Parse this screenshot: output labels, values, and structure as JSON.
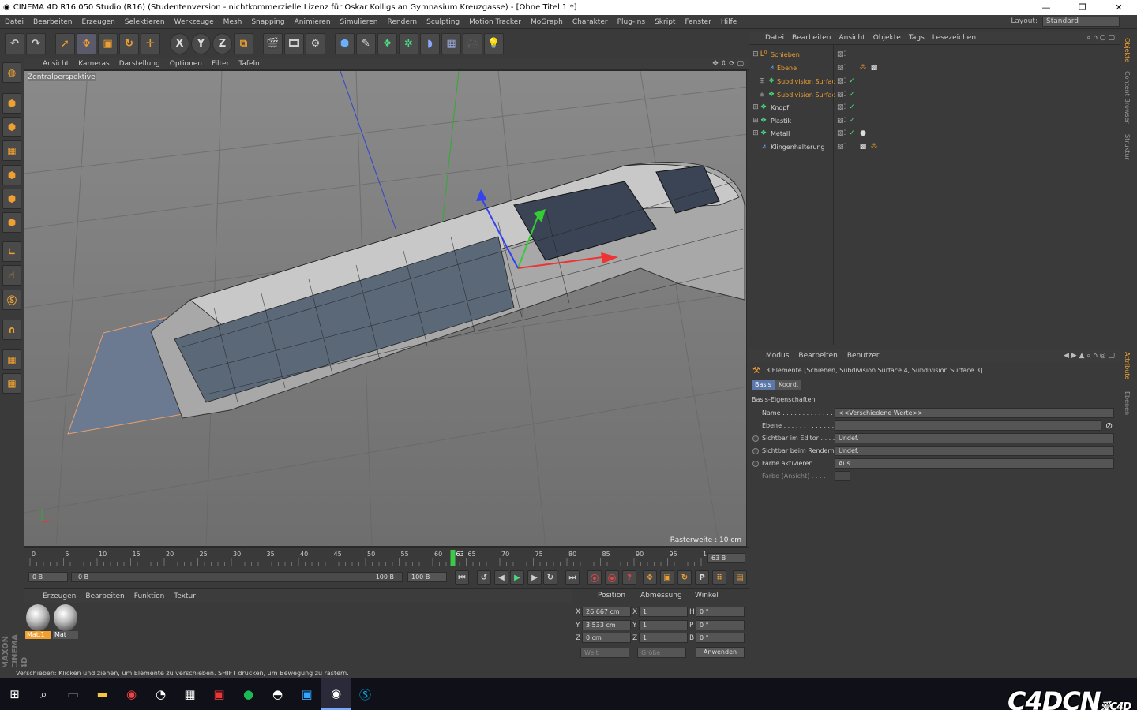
{
  "title": "CINEMA 4D R16.050 Studio (R16) (Studentenversion - nichtkommerzielle Lizenz für Oskar Kolligs an Gymnasium Kreuzgasse) - [Ohne Titel 1 *]",
  "menu": [
    "Datei",
    "Bearbeiten",
    "Erzeugen",
    "Selektieren",
    "Werkzeuge",
    "Mesh",
    "Snapping",
    "Animieren",
    "Simulieren",
    "Rendern",
    "Sculpting",
    "Motion Tracker",
    "MoGraph",
    "Charakter",
    "Plug-ins",
    "Skript",
    "Fenster",
    "Hilfe"
  ],
  "layout": {
    "label": "Layout:",
    "value": "Standard"
  },
  "toolbar": {
    "x": "X",
    "y": "Y",
    "z": "Z"
  },
  "viewport": {
    "menu": [
      "Ansicht",
      "Kameras",
      "Darstellung",
      "Optionen",
      "Filter",
      "Tafeln"
    ],
    "label": "Zentralperspektive",
    "raster": "Rasterweite : 10 cm"
  },
  "timeline": {
    "ticks": [
      "0",
      "5",
      "10",
      "15",
      "20",
      "25",
      "30",
      "35",
      "40",
      "45",
      "50",
      "55",
      "60",
      "65",
      "70",
      "75",
      "80",
      "85",
      "90",
      "95",
      "100"
    ],
    "current": "63",
    "frame_field": "63 B",
    "start": "0 B",
    "range_start": "0 B",
    "range_end": "100 B",
    "end": "100 B"
  },
  "material": {
    "menu": [
      "Erzeugen",
      "Bearbeiten",
      "Funktion",
      "Textur"
    ],
    "items": [
      "Mat.1",
      "Mat"
    ],
    "brand": "MAXON CINEMA 4D"
  },
  "coords": {
    "headers": [
      "Position",
      "Abmessung",
      "Winkel"
    ],
    "rows": [
      {
        "axis": "X",
        "pos": "26.667 cm",
        "size_axis": "X",
        "size": "1",
        "rot_axis": "H",
        "rot": "0 °"
      },
      {
        "axis": "Y",
        "pos": "3.533 cm",
        "size_axis": "Y",
        "size": "1",
        "rot_axis": "P",
        "rot": "0 °"
      },
      {
        "axis": "Z",
        "pos": "0 cm",
        "size_axis": "Z",
        "size": "1",
        "rot_axis": "B",
        "rot": "0 °"
      }
    ],
    "mode1": "Welt",
    "mode2": "Größe",
    "apply": "Anwenden"
  },
  "status": "Verschieben: Klicken und ziehen, um Elemente zu verschieben. SHIFT drücken, um Bewegung zu rastern.",
  "objects": {
    "menu": [
      "Datei",
      "Bearbeiten",
      "Ansicht",
      "Objekte",
      "Tags",
      "Lesezeichen"
    ],
    "items": [
      {
        "name": "Schieben",
        "selected": true
      },
      {
        "name": "Ebene",
        "selected": true
      },
      {
        "name": "Subdivision Surfac",
        "selected": true
      },
      {
        "name": "Subdivision Surfac",
        "selected": true
      },
      {
        "name": "Knopf",
        "selected": false
      },
      {
        "name": "Plastik",
        "selected": false
      },
      {
        "name": "Metall",
        "selected": false
      },
      {
        "name": "Klingenhalterung",
        "selected": false
      }
    ]
  },
  "attributes": {
    "menu": [
      "Modus",
      "Bearbeiten",
      "Benutzer"
    ],
    "info": "3 Elemente [Schieben, Subdivision Surface.4, Subdivision Surface.3]",
    "tabs": [
      "Basis",
      "Koord."
    ],
    "section": "Basis-Eigenschaften",
    "rows": [
      {
        "label": "Name . . . . . . . . . . . . . .",
        "value": "<<Verschiedene Werte>>"
      },
      {
        "label": "Ebene . . . . . . . . . . . . . .",
        "value": ""
      },
      {
        "label": "Sichtbar im Editor . . . .",
        "value": "Undef."
      },
      {
        "label": "Sichtbar beim Rendern",
        "value": "Undef."
      },
      {
        "label": "Farbe aktivieren . . . . .",
        "value": "Aus"
      },
      {
        "label": "Farbe (Ansicht) . . . .",
        "value": ""
      }
    ]
  },
  "side_tabs": [
    "Objekte",
    "Content Browser",
    "Struktur",
    "Attribute",
    "Ebenen"
  ],
  "watermark": {
    "main": "C4DCN",
    "sub": "爱C4D",
    ".com": ".com"
  }
}
